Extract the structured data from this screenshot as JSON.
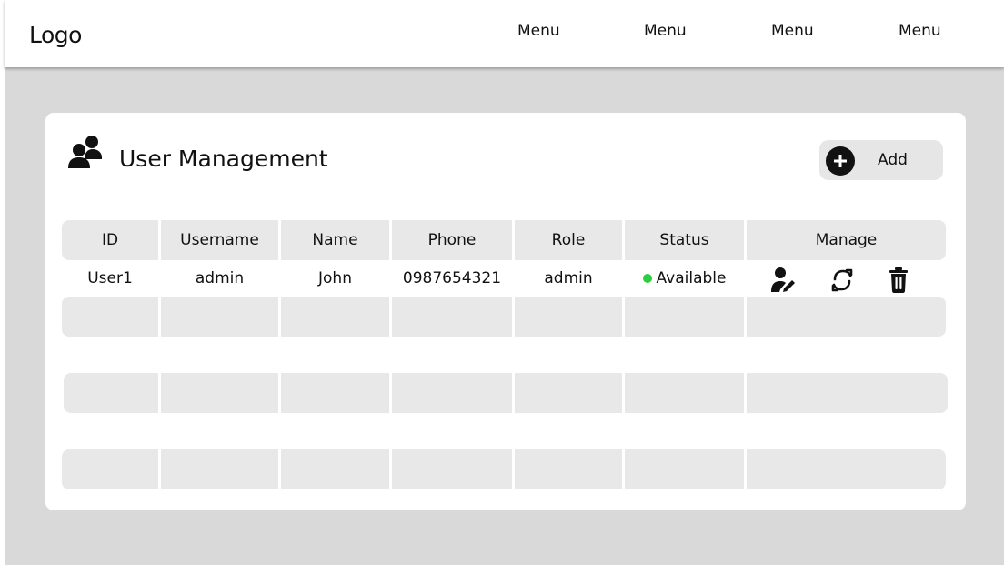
{
  "header": {
    "logo": "Logo",
    "menu": [
      "Menu",
      "Menu",
      "Menu",
      "Menu"
    ]
  },
  "panel": {
    "title": "User Management",
    "title_icon": "users-icon",
    "add_label": "Add",
    "add_icon": "plus-circle-icon"
  },
  "table": {
    "columns": [
      "ID",
      "Username",
      "Name",
      "Phone",
      "Role",
      "Status",
      "Manage"
    ],
    "rows": [
      {
        "id": "User1",
        "username": "admin",
        "name": "John",
        "phone": "0987654321",
        "role": "admin",
        "status": "Available",
        "status_color": "#2ecc40",
        "actions": [
          "edit-user-icon",
          "refresh-icon",
          "trash-icon"
        ]
      }
    ]
  },
  "colors": {
    "workspace": "#d9d9d9",
    "cell": "#e8e8e8",
    "card": "#ffffff"
  }
}
